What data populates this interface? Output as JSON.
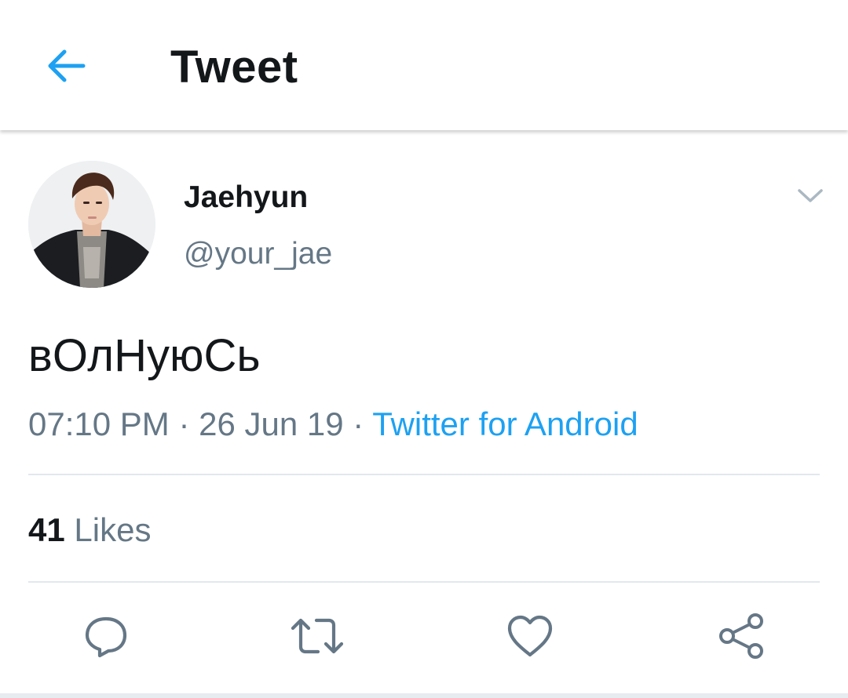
{
  "header": {
    "back_icon": "arrow-left-icon",
    "title": "Tweet",
    "accent_color": "#1da1f2"
  },
  "author": {
    "display_name": "Jaehyun",
    "handle": "@your_jae",
    "menu_icon": "chevron-down-icon"
  },
  "tweet": {
    "text": "вОлНуюСь",
    "time": "07:10 PM",
    "separator": "·",
    "date": "26 Jun 19",
    "source": "Twitter for Android"
  },
  "stats": {
    "likes_count": "41",
    "likes_label": "Likes"
  },
  "actions": [
    {
      "icon": "reply-icon"
    },
    {
      "icon": "retweet-icon"
    },
    {
      "icon": "heart-icon"
    },
    {
      "icon": "share-icon"
    }
  ],
  "colors": {
    "text_primary": "#14171a",
    "text_secondary": "#657786",
    "link": "#1da1f2",
    "divider": "#e1e8ed"
  }
}
